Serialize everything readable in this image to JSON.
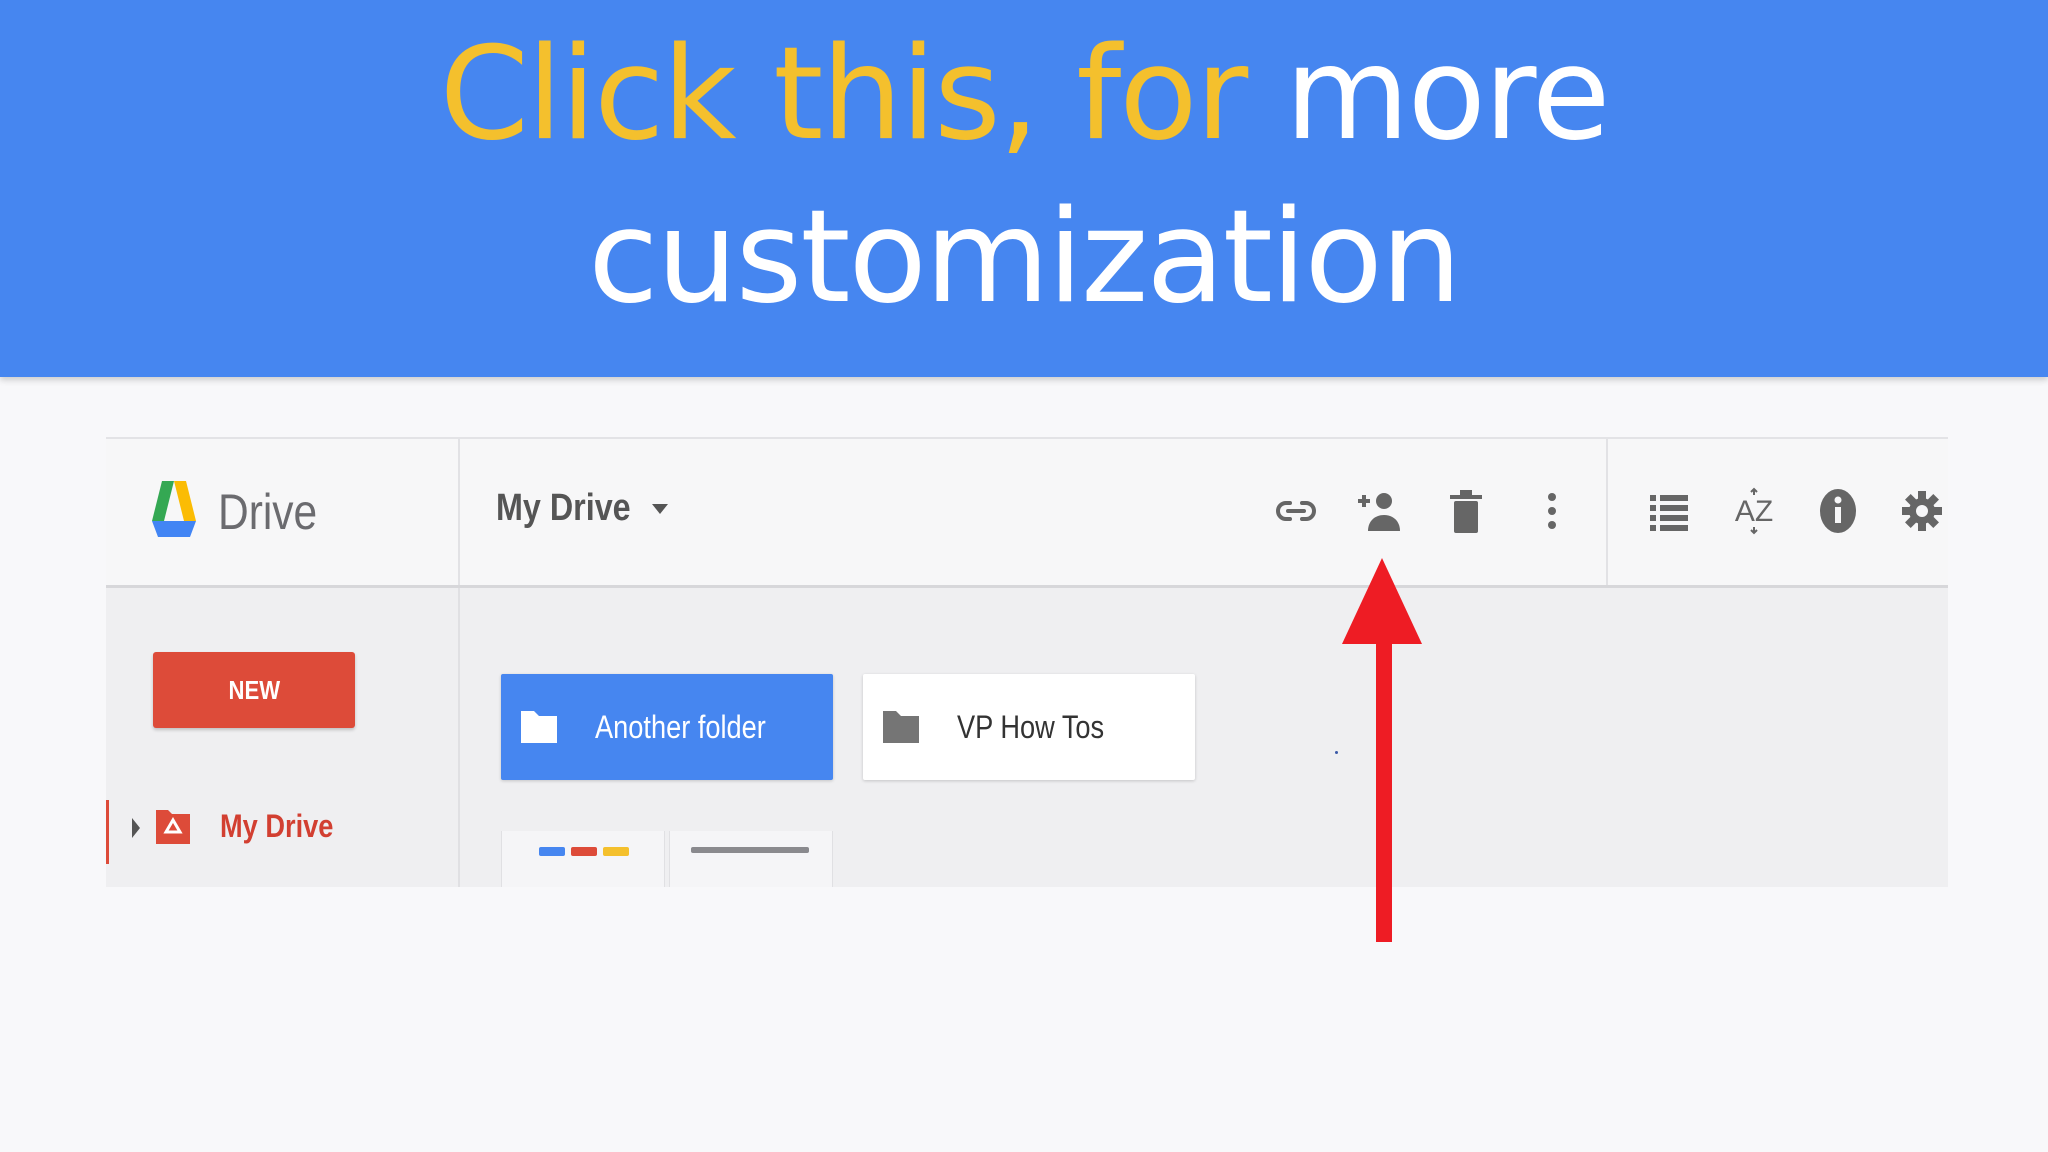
{
  "banner": {
    "highlight_text": "Click this, for ",
    "rest_text": "more",
    "line2_text": "customization",
    "highlight_color": "#f4c02d",
    "background_color": "#4686f0"
  },
  "drive": {
    "app_name": "Drive",
    "breadcrumb": "My Drive",
    "new_button": "NEW",
    "nav": {
      "my_drive": "My Drive"
    },
    "folders": [
      {
        "name": "Another folder",
        "selected": true
      },
      {
        "name": "VP How Tos",
        "selected": false
      }
    ],
    "toolbar_icons": [
      "link-icon",
      "add-person-icon",
      "trash-icon",
      "more-vert-icon",
      "list-view-icon",
      "sort-az-icon",
      "info-icon",
      "settings-gear-icon"
    ],
    "accent_color": "#dd4b39"
  },
  "annotation": {
    "arrow_color": "#ee1c24",
    "points_to": "add-person-icon"
  }
}
